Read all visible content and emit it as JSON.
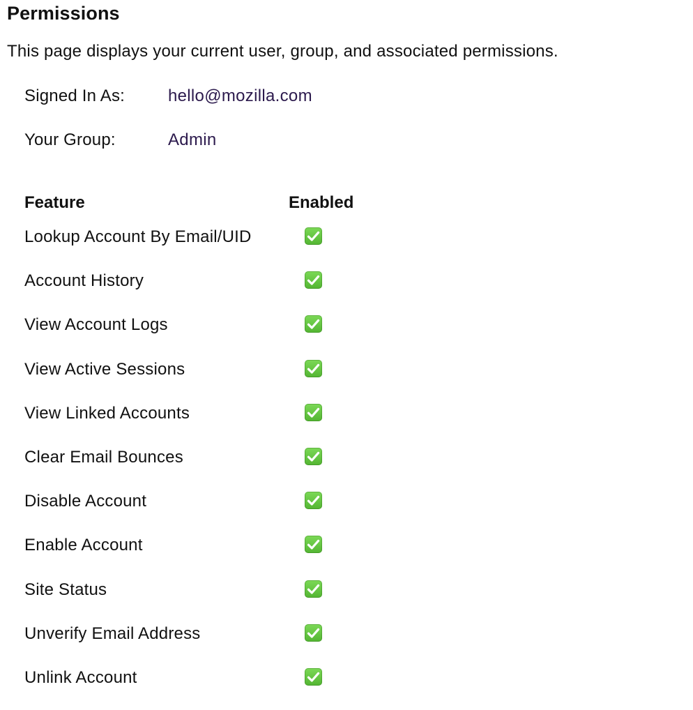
{
  "page": {
    "title": "Permissions",
    "description": "This page displays your current user, group, and associated permissions."
  },
  "account": {
    "signed_in_label": "Signed In As:",
    "signed_in_value": "hello@mozilla.com",
    "group_label": "Your Group:",
    "group_value": "Admin"
  },
  "permissions": {
    "headers": {
      "feature": "Feature",
      "enabled": "Enabled"
    },
    "enabled_icon": "check-mark-button-icon",
    "check_color": "#5ec43c",
    "rows": [
      {
        "feature": "Lookup Account By Email/UID",
        "enabled": true
      },
      {
        "feature": "Account History",
        "enabled": true
      },
      {
        "feature": "View Account Logs",
        "enabled": true
      },
      {
        "feature": "View Active Sessions",
        "enabled": true
      },
      {
        "feature": "View Linked Accounts",
        "enabled": true
      },
      {
        "feature": "Clear Email Bounces",
        "enabled": true
      },
      {
        "feature": "Disable Account",
        "enabled": true
      },
      {
        "feature": "Enable Account",
        "enabled": true
      },
      {
        "feature": "Site Status",
        "enabled": true
      },
      {
        "feature": "Unverify Email Address",
        "enabled": true
      },
      {
        "feature": "Unlink Account",
        "enabled": true
      }
    ]
  }
}
